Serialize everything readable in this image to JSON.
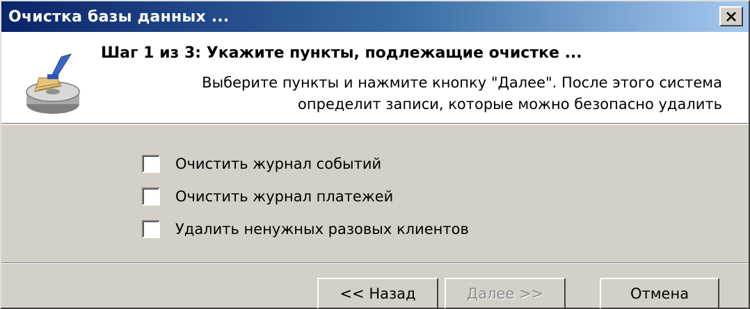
{
  "window": {
    "title": "Очистка базы данных ...",
    "close_symbol": "✕",
    "colors": {
      "titlebar_start": "#0a246a",
      "titlebar_end": "#a6caf0",
      "face": "#d4d0c8"
    }
  },
  "header": {
    "step_title": "Шаг 1 из 3: Укажите пункты, подлежащие очистке  ...",
    "description_line1": "Выберите пункты и нажмите кнопку \"Далее\". После этого система",
    "description_line2": "определит записи, которые можно безопасно удалить",
    "icon": "broom-disk-icon"
  },
  "options": [
    {
      "label": "Очистить журнал событий",
      "checked": false
    },
    {
      "label": "Очистить журнал платежей",
      "checked": false
    },
    {
      "label": "Удалить ненужных разовых клиентов",
      "checked": false
    }
  ],
  "buttons": {
    "back": "<< Назад",
    "next": "Далее >>",
    "next_enabled": false,
    "cancel": "Отмена"
  }
}
